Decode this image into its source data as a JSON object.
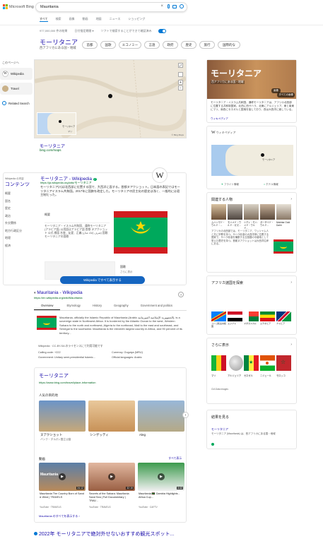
{
  "header": {
    "brand": "Microsoft Bing",
    "query": "Mauritania",
    "tabs": [
      "すべて",
      "検索",
      "画像",
      "動画",
      "地図",
      "ニュース",
      "ショッピング"
    ],
    "result_count": "977,000,000 件の結果",
    "date_filter": "日付指定期間 ▾",
    "safe_search": "ソフトで検索することができて確認済み"
  },
  "entity": {
    "title": "モーリタニア",
    "subtitle": "西アフリカにある国・地域",
    "chips": [
      "首都",
      "国歌",
      "エコノミー",
      "言語",
      "政府",
      "歴史",
      "旅行",
      "国際的な"
    ]
  },
  "sidebar": {
    "heading": "このページへ",
    "items": [
      {
        "label": "Wikipedia"
      },
      {
        "label": "Travel"
      },
      {
        "label": "Related Search"
      }
    ]
  },
  "map": {
    "label": "モーリタニア",
    "url": "bing.com/maps",
    "copyright": "© Bing Maps",
    "country_label": "モーリタニア",
    "inset_label": "マリ"
  },
  "wiki": {
    "title": "モーリタニア - Wikipedia",
    "verified": "✓",
    "url": "https://ja.wikipedia.org/wiki/モーリタニア",
    "snippet": "モーリタニア(A)は北西部に位置する国で、大西洋に面する。首都ヌアクショット。日本語の表記ではモーリタニアイスラム共和国。2017年に国旗を改定した。モーリタニアの民主化の歴史は浅く、一般的には君主制だった。",
    "toc_title": "コンテンツ",
    "toc_source": "Wikipedia の内容",
    "toc": [
      "概要",
      "国名",
      "歴史",
      "政治",
      "外交関係",
      "地方行政区分",
      "地理",
      "経済"
    ],
    "infobox_head": "概要",
    "infobox_text": "モーリタニア・イスラム共和国、通称モーリタニア(アラビア語) 公用語はアラビア語 首都 ヌアクショット 公式 標語 名誉、友愛、正義 (ﺷﺮﻑ ﺇﺧﺎﺀ ﻋﺪﻝ) 国歌 モーリタニアの国歌",
    "infobox_note": "国歌",
    "cta": "Wikipedia ですべて表示する",
    "cta_extra": "さらに表示"
  },
  "en_wiki": {
    "title": "Mauritania - Wikipedia",
    "url": "https://en.wikipedia.org/wiki/Mauritania",
    "tabs": [
      "Overview",
      "Etymology",
      "History",
      "Geography",
      "Government and politics"
    ],
    "snippet": "Mauritania, officially the Islamic Republic of Mauritania (Arabic الجمهورية الإسلامية الموريتانية), is a sovereign state in Northwest Africa. It is bordered by the Atlantic Ocean to the west, Western Sahara to the north and northwest, Algeria to the northeast, Mali to the east and southeast, and Senegal to the southwest. Mauritania is the eleventh largest country in Africa, and 90 percent of its territory...",
    "license": "Wikipedia · CC-BY-SA のライセンスにて利用可能です",
    "facts": [
      "Calling code: +222",
      "Currency: Ouguiya (MRU)",
      "Government: Unitary semi-presidential Islamic...",
      "Official languages: Arabic"
    ]
  },
  "travel": {
    "title": "モーリタニア",
    "url": "https://www.bing.com/travel/place-information",
    "popular_heading": "人気の目的地",
    "places": [
      {
        "name": "ヌアクショット",
        "sub": "バンク・ダルガン国立公園"
      },
      {
        "name": "シンゲッティ",
        "sub": ""
      },
      {
        "name": "Aleg",
        "sub": ""
      }
    ],
    "videos_heading": "動画",
    "videos_more": "すべて表示",
    "videos": [
      {
        "title": "Mauritania The Country Born of Sand & Wind | TRAVELS",
        "source": "YouTube · TRAVELS",
        "duration": "24:12",
        "badge": "Mauritania"
      },
      {
        "title": "Secrets of the Sahara: Mauritania Sand Sea | Full Documentary | TRAV...",
        "source": "YouTube · TRAVELS",
        "duration": "32:15",
        "badge": ""
      },
      {
        "title": "Mauritania 🇲🇷 Gambia Highlights - Africa Cup...",
        "source": "YouTube · CAFTV",
        "duration": "4:42",
        "badge": ""
      }
    ],
    "more_link": "Mauritania のすべてを表示する ›"
  },
  "bottom": {
    "title": "2022年 モーリタニアで絶対外せないおすすめ観光スポット..."
  },
  "panel": {
    "title": "モーリタニア",
    "sub": "西アフリカにある国・地域",
    "images_label": "画像",
    "more_images": "すべての画像",
    "description": "モーリタニア・イスラム共和国、通称モーリタニアは、アフリカ北西部に位置する共和制国家。北西に西サハラ、北東にアルジェリア、東と南東にマリ、南西にセネガルと国境を接しており、西は大西洋に面している。",
    "desc_source": "ウィキペディア",
    "wiki_label": "ウィキペディア",
    "map_label": "モーリタニア",
    "flag_label": "フライト情報",
    "hotel_label": "ホテル情報",
    "people_heading": "関連する人物",
    "people": [
      {
        "name": "ムハンマド・ウルド・..."
      },
      {
        "name": "モハメド・ウルド・ガズ..."
      },
      {
        "name": "シディ・モハメド・ウルド..."
      },
      {
        "name": "ガーザイド・ウルド..."
      },
      {
        "name": "Mokhtar Ould Dahh"
      }
    ],
    "country_text": "アフリカの北西部では、モーリタニア、ワッシャム人と共に宗教を持つ。サハラ砂漠の大西洋岸に位置する国家で、サハラ砂漠を横断する交易路の中継地として栄えた歴史を持つ。首都ヌアクショットは大西洋沿岸にある。",
    "africa_heading": "アフリカ諸国を探索",
    "africa": [
      "コンゴ民主共和国",
      "エジプト",
      "マダガスカル",
      "エチオピア",
      "ナミビア"
    ],
    "more_heading": "さらに表示",
    "more_list": [
      "マリ",
      "アルジェリア",
      "セネガル",
      "ニジェール",
      "モロッコ"
    ],
    "data_source": "CIA Data images",
    "results_heading": "結果を見る",
    "results_item": "モーリタニア",
    "results_text": "モーリタニア (Mauritania) は、西アフリカにある国・地域"
  },
  "colors": {
    "accent": "#0078d4",
    "mauritania_green": "#00a95c",
    "mauritania_red": "#d01c1f",
    "mauritania_gold": "#ffd700"
  }
}
